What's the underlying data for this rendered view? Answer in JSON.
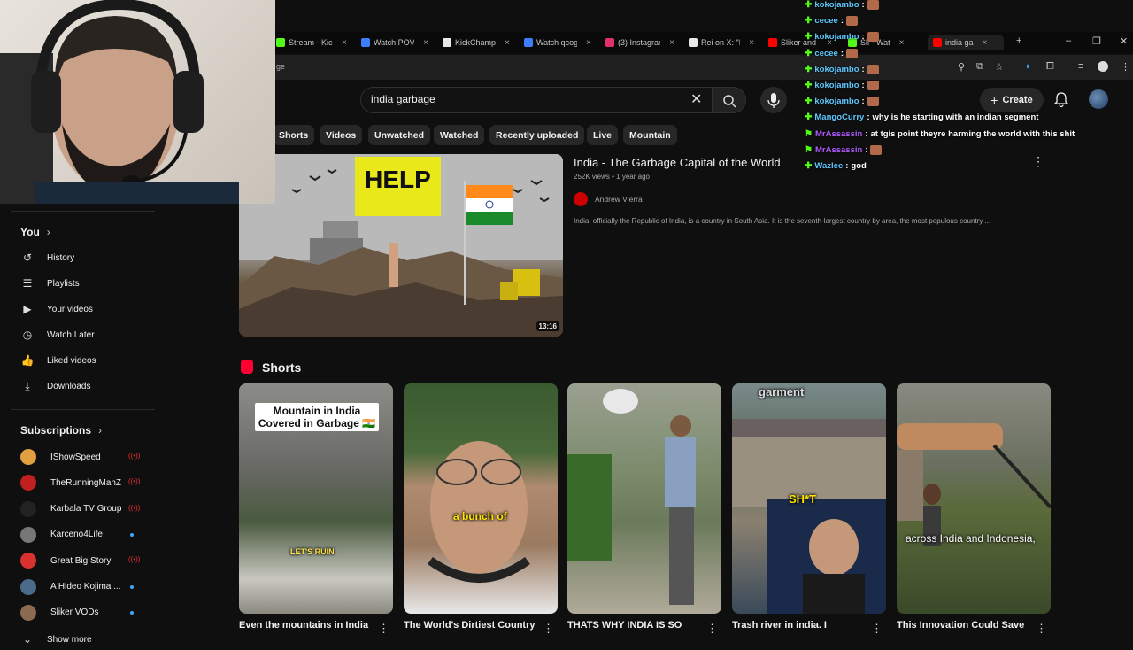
{
  "browser": {
    "tabs": [
      {
        "label": "Stream - Kick",
        "color": "#53fc18"
      },
      {
        "label": "Watch POV",
        "color": "#3d7eff"
      },
      {
        "label": "KickChamp",
        "color": "#e8e8e8"
      },
      {
        "label": "Watch qcog",
        "color": "#3d7eff"
      },
      {
        "label": "(3) Instagram",
        "color": "#e1306c"
      },
      {
        "label": "Rei on X: \"M",
        "color": "#e8e8e8"
      },
      {
        "label": "Sliker and A",
        "color": "#ff0000"
      },
      {
        "label": "Sli - Wat",
        "color": "#53fc18"
      },
      {
        "label": "india ga",
        "color": "#ff0000"
      }
    ],
    "address_fragment": "ge"
  },
  "header": {
    "search_query": "india garbage",
    "create_label": "Create"
  },
  "chips": [
    "Shorts",
    "Videos",
    "Unwatched",
    "Watched",
    "Recently uploaded",
    "Live",
    "Mountain"
  ],
  "sidebar": {
    "you_label": "You",
    "you_items": [
      {
        "label": "History",
        "icon": "history-icon"
      },
      {
        "label": "Playlists",
        "icon": "playlists-icon"
      },
      {
        "label": "Your videos",
        "icon": "your-videos-icon"
      },
      {
        "label": "Watch Later",
        "icon": "watch-later-icon"
      },
      {
        "label": "Liked videos",
        "icon": "like-icon"
      },
      {
        "label": "Downloads",
        "icon": "download-icon"
      }
    ],
    "subscriptions_label": "Subscriptions",
    "subscriptions": [
      {
        "name": "IShowSpeed",
        "status": "live",
        "color": "#e0a040"
      },
      {
        "name": "TheRunningManZ",
        "status": "live",
        "color": "#c02020"
      },
      {
        "name": "Karbala TV Group",
        "status": "live",
        "color": "#222222"
      },
      {
        "name": "Karceno4Life",
        "status": "new",
        "color": "#777777"
      },
      {
        "name": "Great Big Story",
        "status": "live",
        "color": "#d93030"
      },
      {
        "name": "A Hideo Kojima ...",
        "status": "new",
        "color": "#4a6a8a"
      },
      {
        "name": "Sliker VODs",
        "status": "new",
        "color": "#8a6a50"
      }
    ],
    "show_more": "Show more"
  },
  "main_video": {
    "title": "India - The Garbage Capital of the World",
    "views": "252K views",
    "age": "1 year ago",
    "channel": "Andrew Vierra",
    "description": "India, officially the Republic of India, is a country in South Asia. It is the seventh-largest country by area, the most populous country ...",
    "duration": "13:16",
    "thumb_sign": "HELP"
  },
  "shorts_section": {
    "title": "Shorts",
    "items": [
      {
        "title": "Even the mountains in India",
        "caption": "Mountain in India Covered in Garbage 🇮🇳",
        "overlay": "LET'S RUIN"
      },
      {
        "title": "The World's Dirtiest Country",
        "caption": "a bunch of"
      },
      {
        "title": "THATS WHY INDIA IS SO",
        "caption": ""
      },
      {
        "title": "Trash river in india. I",
        "caption": "SH*T",
        "top_caption": "garment"
      },
      {
        "title": "This Innovation Could Save",
        "caption": "across India and Indonesia,"
      }
    ]
  },
  "chat": [
    {
      "user": "kokojambo",
      "text": "",
      "emote": true,
      "color": "blue"
    },
    {
      "user": "cecee",
      "text": "",
      "emote": true,
      "color": "blue"
    },
    {
      "user": "kokojambo",
      "text": "",
      "emote": true,
      "color": "blue"
    },
    {
      "user": "cecee",
      "text": "",
      "emote": true,
      "color": "blue"
    },
    {
      "user": "kokojambo",
      "text": "",
      "emote": true,
      "color": "blue"
    },
    {
      "user": "kokojambo",
      "text": "",
      "emote": true,
      "color": "blue"
    },
    {
      "user": "kokojambo",
      "text": "",
      "emote": true,
      "color": "blue"
    },
    {
      "user": "MangoCurry",
      "text": "why is he starting with an indian segment",
      "emote": false,
      "color": "blue"
    },
    {
      "user": "MrAssassin",
      "text": "at tgis point theyre harming the world with this shit",
      "emote": false,
      "color": "purple"
    },
    {
      "user": "MrAssassin",
      "text": "",
      "emote": true,
      "color": "purple"
    },
    {
      "user": "Wazlee",
      "text": "god",
      "emote": false,
      "color": "blue"
    }
  ]
}
